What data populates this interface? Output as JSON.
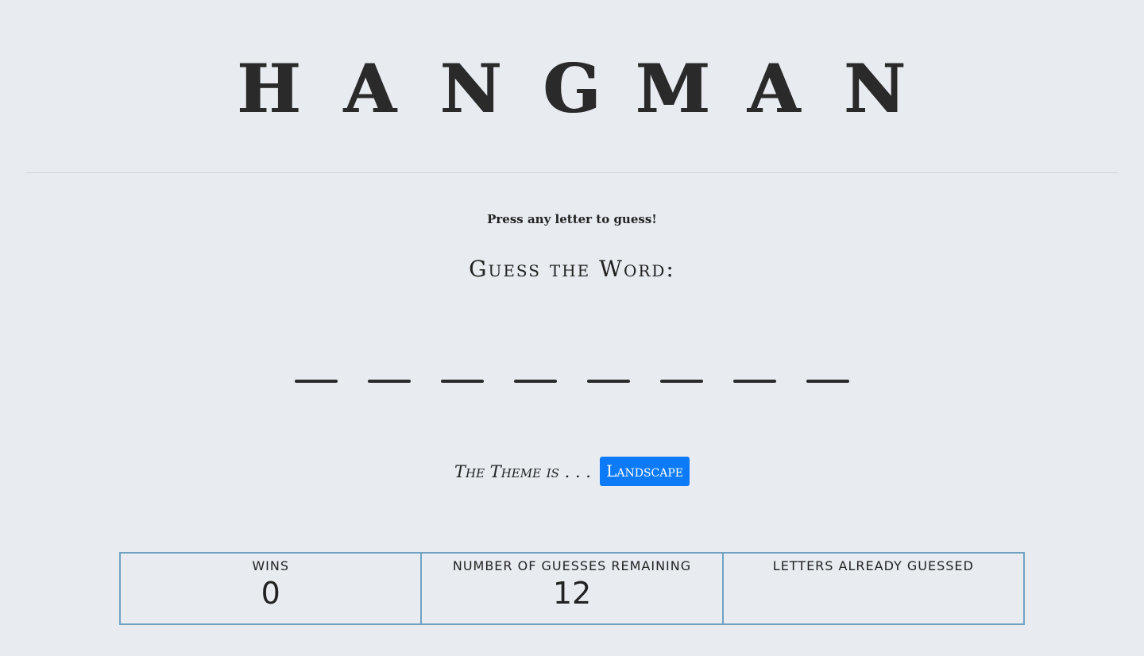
{
  "title": {
    "letters": [
      "H",
      "A",
      "N",
      "G",
      "M",
      "A",
      "N"
    ]
  },
  "instructions": "Press any letter to guess!",
  "guess_heading": "Guess the Word:",
  "word": {
    "blank_count": 8
  },
  "theme": {
    "label": "The Theme is . . .",
    "value": "Landscape"
  },
  "stats": {
    "wins_label": "Wins",
    "wins_value": "0",
    "remaining_label": "Number of Guesses Remaining",
    "remaining_value": "12",
    "guessed_label": "Letters Already Guessed",
    "guessed_value": ""
  },
  "colors": {
    "background": "#e8ecf0",
    "badge": "#0d7af7",
    "table_border": "#6fa1c3",
    "text": "#222222"
  }
}
